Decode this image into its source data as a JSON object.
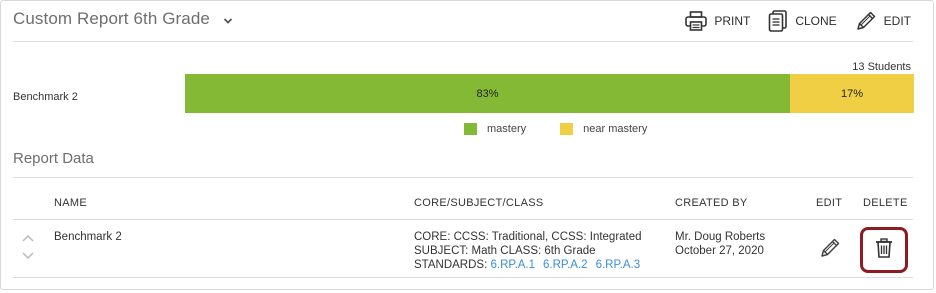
{
  "header": {
    "title": "Custom Report 6th Grade",
    "actions": [
      {
        "label": "PRINT",
        "icon": "printer-icon"
      },
      {
        "label": "CLONE",
        "icon": "clone-icon"
      },
      {
        "label": "EDIT",
        "icon": "pencil-icon"
      }
    ]
  },
  "chart_data": {
    "type": "bar",
    "orientation": "horizontal-stacked",
    "categories": [
      "Benchmark 2"
    ],
    "series": [
      {
        "name": "mastery",
        "values": [
          83
        ],
        "label": "83%",
        "color": "#84b935"
      },
      {
        "name": "near mastery",
        "values": [
          17
        ],
        "label": "17%",
        "color": "#f0cf45"
      }
    ],
    "annotation": "13 Students",
    "legend_position": "bottom-center"
  },
  "report": {
    "section_title": "Report Data",
    "columns": [
      "NAME",
      "CORE/SUBJECT/CLASS",
      "CREATED BY",
      "EDIT",
      "DELETE"
    ],
    "rows": [
      {
        "name": "Benchmark 2",
        "core_line1": "CORE: CCSS: Traditional, CCSS: Integrated",
        "core_line2": "SUBJECT: Math CLASS: 6th Grade",
        "standards_label": "STANDARDS:",
        "standards": [
          "6.RP.A.1",
          "6.RP.A.2",
          "6.RP.A.3"
        ],
        "created_by": "Mr. Doug Roberts",
        "created_on": "October 27, 2020"
      }
    ]
  },
  "colors": {
    "mastery": "#84b935",
    "near_mastery": "#f0cf45",
    "link": "#3a8dd6",
    "delete_highlight": "#8e1b21"
  }
}
